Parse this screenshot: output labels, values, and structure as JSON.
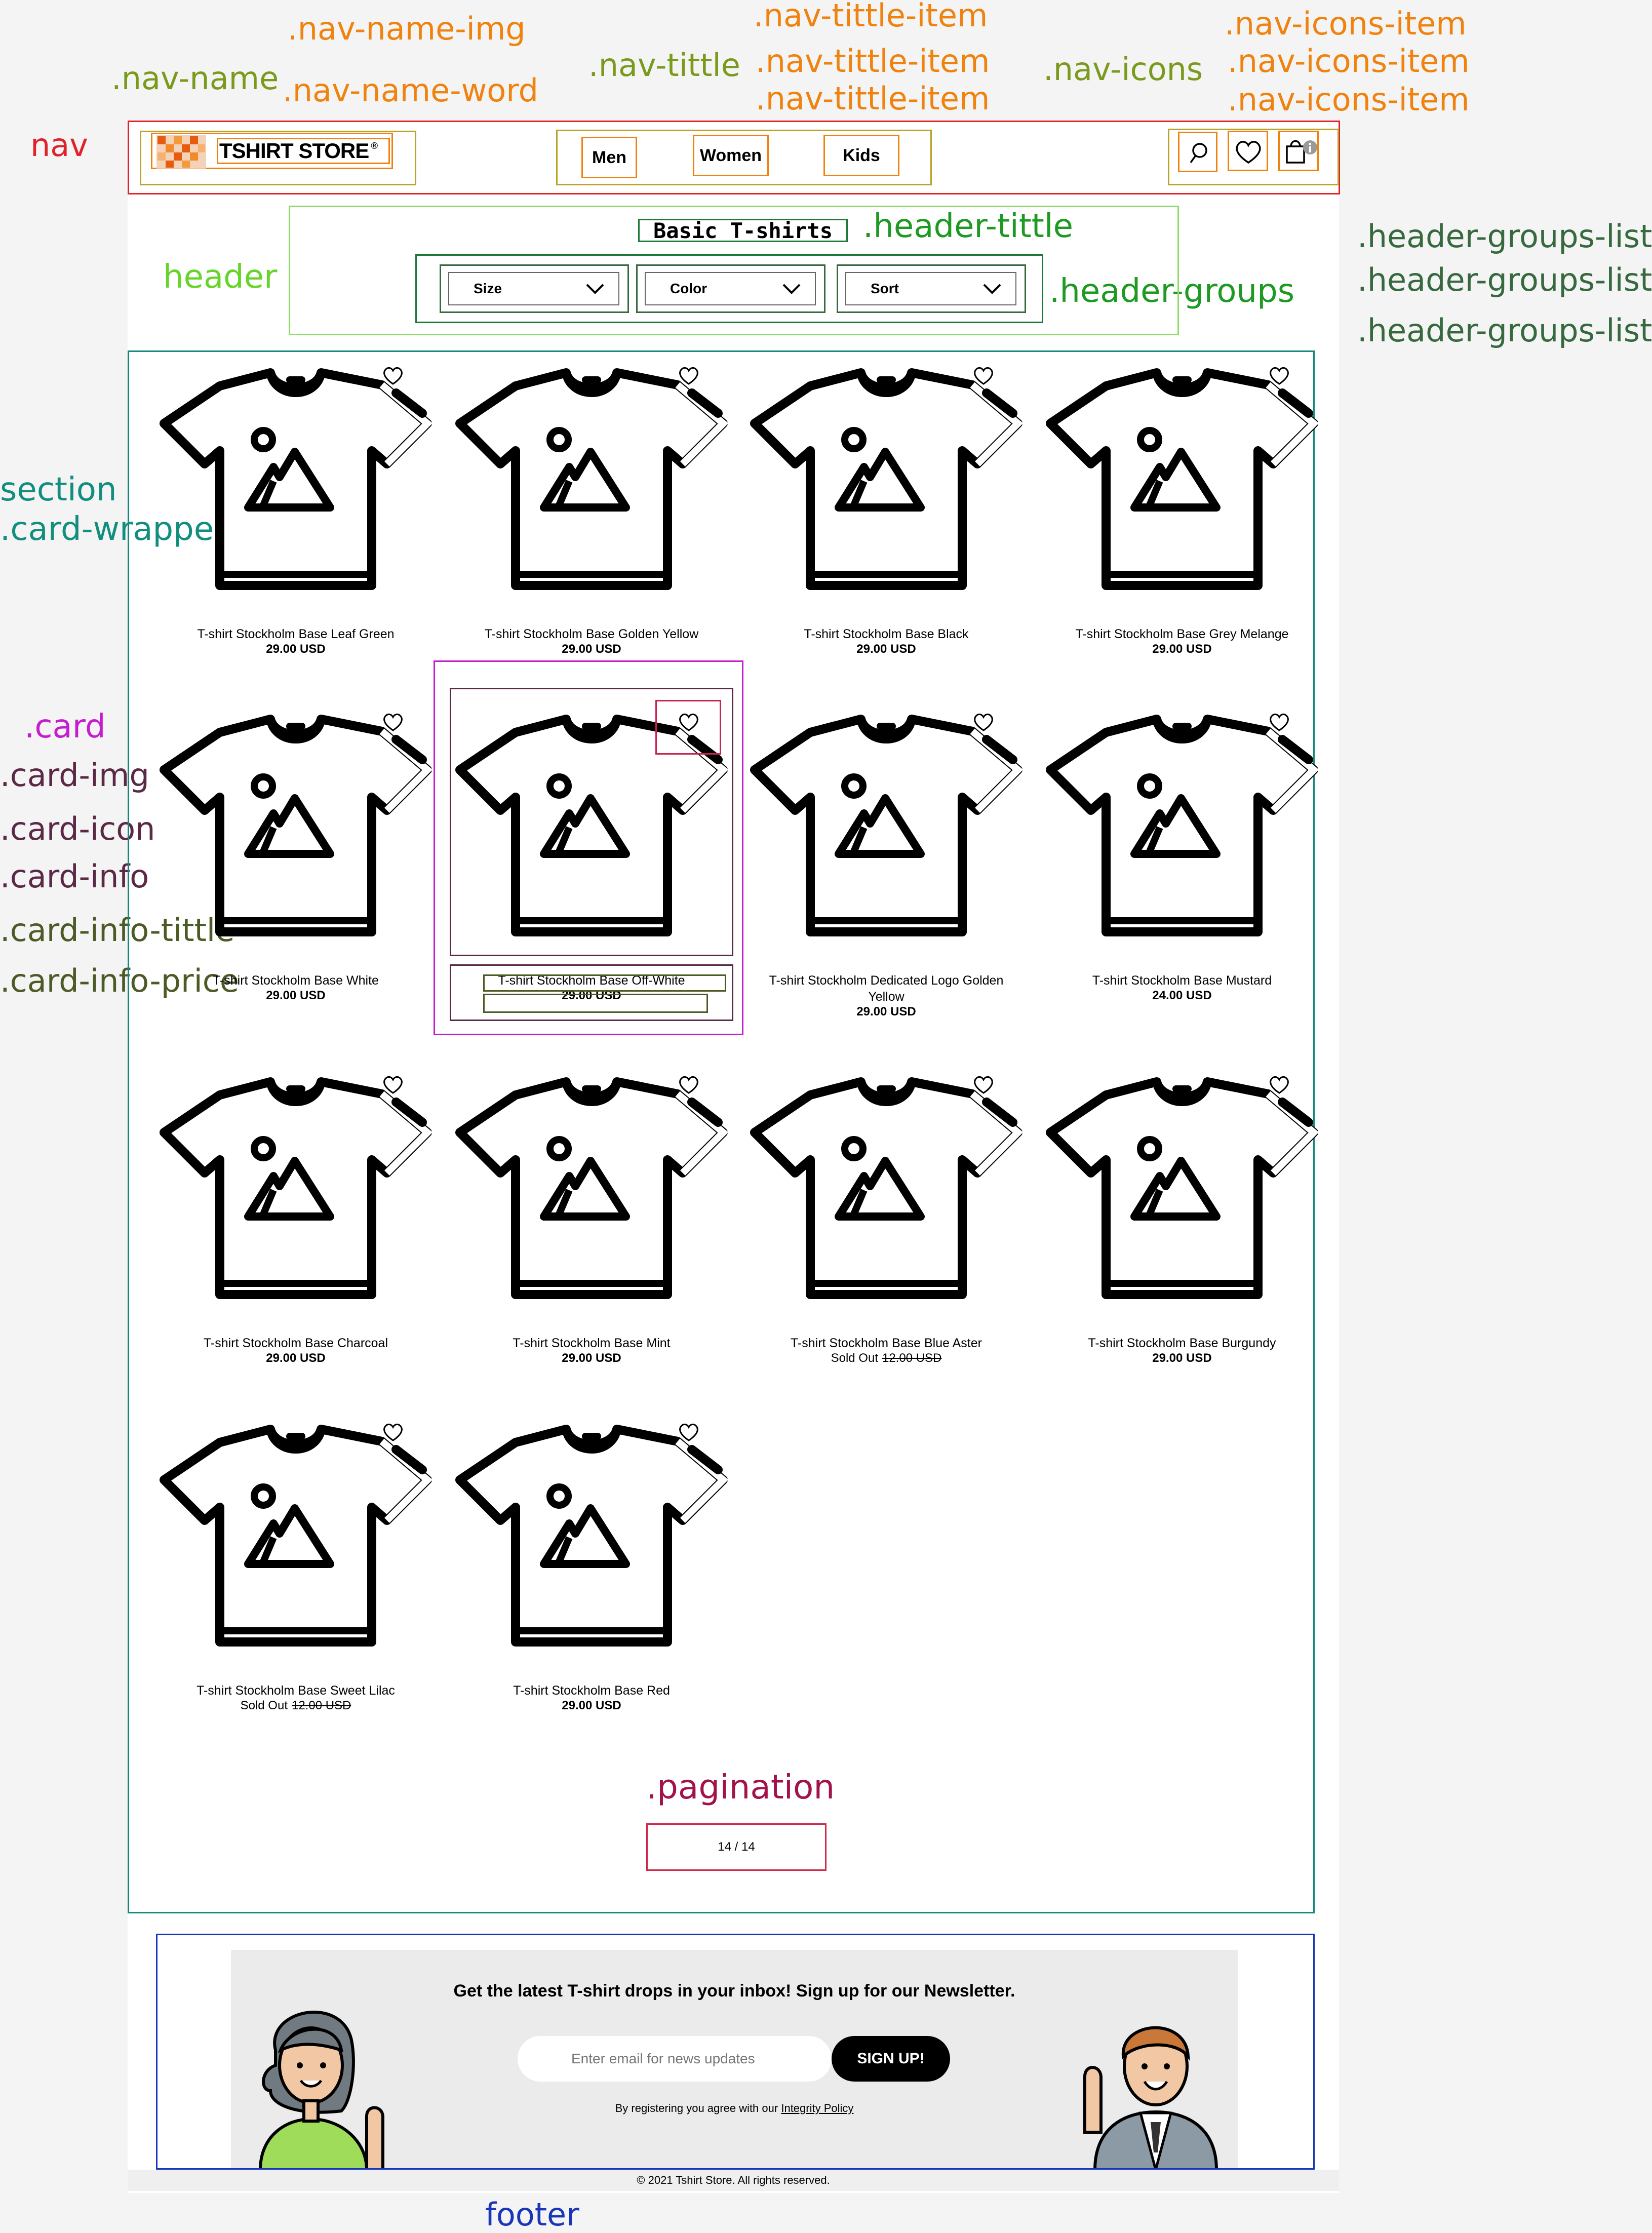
{
  "annotations": {
    "nav_name_img": ".nav-name-img",
    "nav_name": ".nav-name",
    "nav_name_word": ".nav-name-word",
    "nav_tittle": ".nav-tittle",
    "nav_tittle_item_1": ".nav-tittle-item",
    "nav_tittle_item_2": ".nav-tittle-item",
    "nav_tittle_item_3": ".nav-tittle-item",
    "nav_icons": ".nav-icons",
    "nav_icons_item_1": ".nav-icons-item",
    "nav_icons_item_2": ".nav-icons-item",
    "nav_icons_item_3": ".nav-icons-item",
    "nav": "nav",
    "header_tittle": ".header-tittle",
    "header": "header",
    "header_groups": ".header-groups",
    "header_groups_list_1": ".header-groups-list",
    "header_groups_list_2": ".header-groups-list",
    "header_groups_list_3": ".header-groups-list",
    "section": "section",
    "card_wrapper": ".card-wrapper",
    "card": ".card",
    "card_img": ".card-img",
    "card_icon": ".card-icon",
    "card_info": ".card-info",
    "card_info_tittle": ".card-info-tittle",
    "card_info_price": ".card-info-price",
    "pagination": ".pagination",
    "footer": "footer"
  },
  "nav": {
    "brand": "TSHIRT STORE",
    "brand_mark": "®",
    "links": [
      "Men",
      "Women",
      "Kids"
    ],
    "icons": [
      "search-icon",
      "heart-icon",
      "bag-icon"
    ]
  },
  "header": {
    "title": "Basic T-shirts",
    "filters": [
      "Size",
      "Color",
      "Sort"
    ]
  },
  "products": [
    {
      "title": "T-shirt Stockholm Base Leaf Green",
      "price": "29.00 USD"
    },
    {
      "title": "T-shirt Stockholm Base Golden Yellow",
      "price": "29.00 USD"
    },
    {
      "title": "T-shirt Stockholm Base Black",
      "price": "29.00 USD"
    },
    {
      "title": "T-shirt Stockholm Base Grey Melange",
      "price": "29.00 USD"
    },
    {
      "title": "T-shirt Stockholm Base White",
      "price": "29.00 USD"
    },
    {
      "title": "T-shirt Stockholm Base Off-White",
      "price": "29.00 USD"
    },
    {
      "title": "T-shirt Stockholm Dedicated Logo Golden Yellow",
      "price": "29.00 USD"
    },
    {
      "title": "T-shirt Stockholm Base Mustard",
      "price": "24.00 USD"
    },
    {
      "title": "T-shirt Stockholm Base Charcoal",
      "price": "29.00 USD"
    },
    {
      "title": "T-shirt Stockholm Base Mint",
      "price": "29.00 USD"
    },
    {
      "title": "T-shirt Stockholm Base Blue Aster",
      "sold_out": "Sold Out",
      "old_price": "12.00 USD"
    },
    {
      "title": "T-shirt Stockholm Base Burgundy",
      "price": "29.00 USD"
    },
    {
      "title": "T-shirt Stockholm Base Sweet Lilac",
      "sold_out": "Sold Out",
      "old_price": "12.00 USD"
    },
    {
      "title": "T-shirt Stockholm Base Red",
      "price": "29.00 USD"
    }
  ],
  "pagination": {
    "text": "14 / 14"
  },
  "newsletter": {
    "title": "Get the latest T-shirt drops in your inbox! Sign up for our Newsletter.",
    "placeholder": "Enter email for news updates",
    "button": "SIGN UP!",
    "consent": "By registering you agree with our",
    "policy_link": "Integrity Policy"
  },
  "copyright": "© 2021 Tshirt Store. All rights reserved.",
  "colors": {
    "nav_box": "#e0222a",
    "header_box": "#8fdc6a",
    "groups_box": "#1e7a3a",
    "section_box": "#15897c",
    "card_box": "#c51ccf",
    "pagination_box": "#d0284b",
    "footer_box": "#1a36b8",
    "brand_orange": "#f07b1a"
  }
}
